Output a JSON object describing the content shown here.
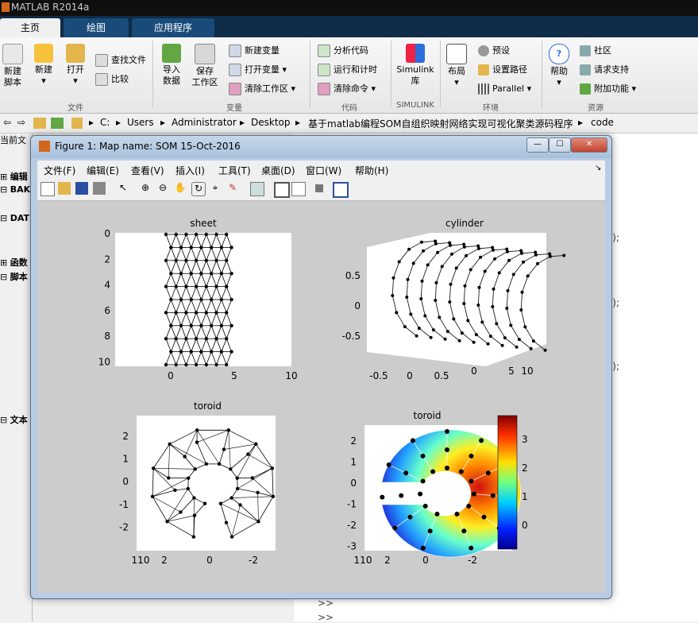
{
  "app": {
    "title": "MATLAB R2014a"
  },
  "ribbon": {
    "tabs": [
      "主页",
      "绘图",
      "应用程序"
    ],
    "home": {
      "new_script": "新建\n脚本",
      "new": "新建",
      "open": "打开",
      "find_files": "查找文件",
      "compare": "比较",
      "import_data": "导入\n数据",
      "save_workspace": "保存\n工作区",
      "new_variable": "新建变量",
      "open_variable": "打开变量",
      "clear_workspace": "清除工作区",
      "analyze_code": "分析代码",
      "run_and_time": "运行和计时",
      "clear_commands": "清除命令",
      "simulink_library": "Simulink\n库",
      "layout": "布局",
      "preferences": "预设",
      "set_path": "设置路径",
      "parallel": "Parallel",
      "help": "帮助",
      "community": "社区",
      "request_support": "请求支持",
      "add_ons": "附加功能"
    },
    "groups": [
      "文件",
      "变量",
      "代码",
      "SIMULINK",
      "环境",
      "资源"
    ]
  },
  "address": {
    "crumbs": [
      "C:",
      "Users",
      "Administrator",
      "Desktop",
      "基于matlab编程SOM自组织映射网络实现可视化聚类源码程序",
      "code"
    ]
  },
  "leftpanel": {
    "header": "当前文",
    "items": [
      "编辑",
      "BAK",
      "DAT",
      "函数",
      "脚本",
      "文本"
    ]
  },
  "cmdwin": {
    "lines": [
      "');",
      "');",
      "');",
      ">>",
      ">>"
    ]
  },
  "figure": {
    "title": "Figure 1: Map name: SOM 15-Oct-2016",
    "menu": [
      "文件(F)",
      "编辑(E)",
      "查看(V)",
      "插入(I)",
      "工具(T)",
      "桌面(D)",
      "窗口(W)",
      "帮助(H)"
    ],
    "plots": {
      "sheet": {
        "title": "sheet",
        "yticks": [
          "0",
          "2",
          "4",
          "6",
          "8",
          "10"
        ],
        "xticks": [
          "0",
          "5",
          "10"
        ]
      },
      "cylinder": {
        "title": "cylinder",
        "yticks": [
          "0.5",
          "0",
          "-0.5"
        ],
        "xticks": [
          "-0.5",
          "0",
          "0.5",
          "0",
          "5",
          "10"
        ]
      },
      "toroid1": {
        "title": "toroid",
        "yticks": [
          "2",
          "1",
          "0",
          "-1",
          "-2"
        ],
        "xticks": [
          "10",
          "2",
          "0",
          "-2"
        ],
        "xtick_prefix": "1"
      },
      "toroid2": {
        "title": "toroid",
        "yticks": [
          "2",
          "1",
          "0",
          "-1",
          "-2",
          "-3"
        ],
        "xticks": [
          "10",
          "2",
          "0",
          "-2"
        ],
        "xtick_prefix": "1"
      },
      "colorbar": {
        "ticks": [
          "3",
          "2",
          "1",
          "0"
        ]
      }
    }
  },
  "colors": {
    "accent": "#194b7a",
    "titlebar": "#0f0f10"
  }
}
